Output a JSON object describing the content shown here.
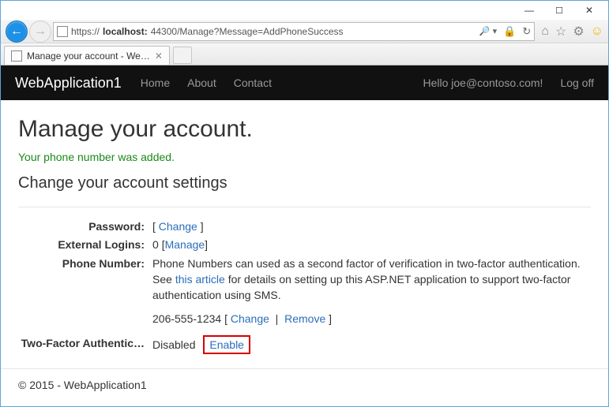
{
  "window": {
    "url_prefix": "https://",
    "url_host": "localhost:",
    "url_rest": "44300/Manage?Message=AddPhoneSuccess",
    "tab_title": "Manage your account - We…"
  },
  "nav": {
    "brand": "WebApplication1",
    "links": [
      "Home",
      "About",
      "Contact"
    ],
    "greeting": "Hello joe@contoso.com!",
    "logoff": "Log off"
  },
  "page": {
    "title": "Manage your account.",
    "success": "Your phone number was added.",
    "subhead": "Change your account settings"
  },
  "settings": {
    "password_label": "Password:",
    "password_change": "Change",
    "ext_label": "External Logins:",
    "ext_count": "0",
    "ext_manage": "Manage",
    "phone_label": "Phone Number:",
    "phone_text_a": "Phone Numbers can used as a second factor of verification in two-factor authentication. See ",
    "phone_link": "this article",
    "phone_text_b": " for details on setting up this ASP.NET application to support two-factor authentication using SMS.",
    "phone_number": "206-555-1234",
    "phone_change": "Change",
    "phone_remove": "Remove",
    "tfa_label": "Two-Factor Authentic…",
    "tfa_status": "Disabled",
    "tfa_enable": "Enable"
  },
  "footer": "© 2015 - WebApplication1"
}
